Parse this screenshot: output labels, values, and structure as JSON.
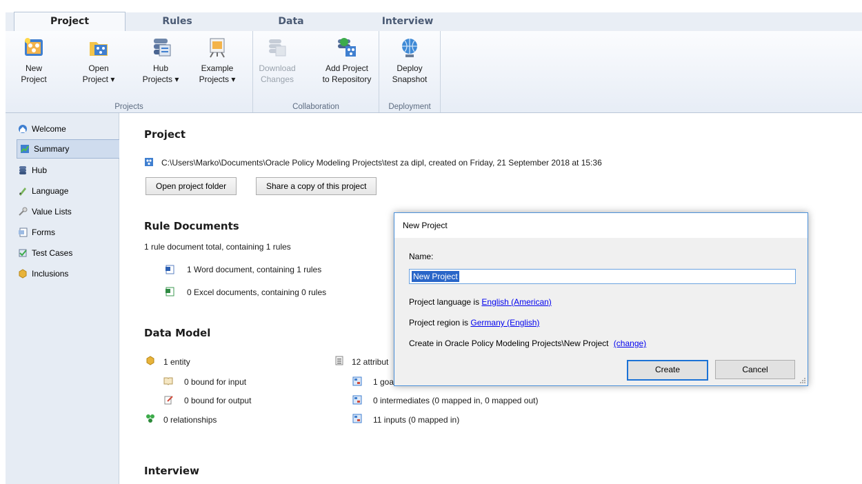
{
  "tabs": [
    "Project",
    "Rules",
    "Data",
    "Interview"
  ],
  "ribbon": {
    "groups": {
      "projects": "Projects",
      "collaboration": "Collaboration",
      "deployment": "Deployment"
    },
    "buttons": {
      "new_project": [
        "New",
        "Project"
      ],
      "open_project": [
        "Open",
        "Project ▾"
      ],
      "hub_projects": [
        "Hub",
        "Projects ▾"
      ],
      "example_projects": [
        "Example",
        "Projects ▾"
      ],
      "download_changes": [
        "Download",
        "Changes"
      ],
      "add_project": [
        "Add Project",
        "to Repository"
      ],
      "deploy_snapshot": [
        "Deploy",
        "Snapshot"
      ]
    }
  },
  "nav": {
    "items": [
      "Welcome",
      "Summary",
      "Hub",
      "Language",
      "Value Lists",
      "Forms",
      "Test Cases",
      "Inclusions"
    ],
    "active": "Summary"
  },
  "main": {
    "project_heading": "Project",
    "project_path": "C:\\Users\\Marko\\Documents\\Oracle Policy Modeling Projects\\test za dipl, created on Friday, 21 September 2018 at 15:36",
    "open_folder_btn": "Open project folder",
    "share_copy_btn": "Share a copy of this project",
    "rule_docs_heading": "Rule Documents",
    "rule_docs_total": "1 rule document total, containing 1 rules",
    "word_docs": "1 Word document, containing 1 rules",
    "excel_docs": "0 Excel documents, containing 0 rules",
    "data_model_heading": "Data Model",
    "entity": "1 entity",
    "bound_input": "0 bound for input",
    "bound_output": "0 bound for output",
    "relationships": "0 relationships",
    "attributes_partial": "12 attribut",
    "goals_partial": "1 goa",
    "intermediates": "0 intermediates (0 mapped in, 0 mapped out)",
    "inputs": "11 inputs (0 mapped in)",
    "interview_heading": "Interview"
  },
  "dialog": {
    "title": "New Project",
    "name_label": "Name:",
    "name_value": "New Project",
    "language_prefix": "Project language is",
    "language_link": "English (American)",
    "region_prefix": "Project region is",
    "region_link": "Germany (English)",
    "location_prefix": "Create in Oracle Policy Modeling Projects\\New Project",
    "change_link": "(change)",
    "create_btn": "Create",
    "cancel_btn": "Cancel"
  }
}
